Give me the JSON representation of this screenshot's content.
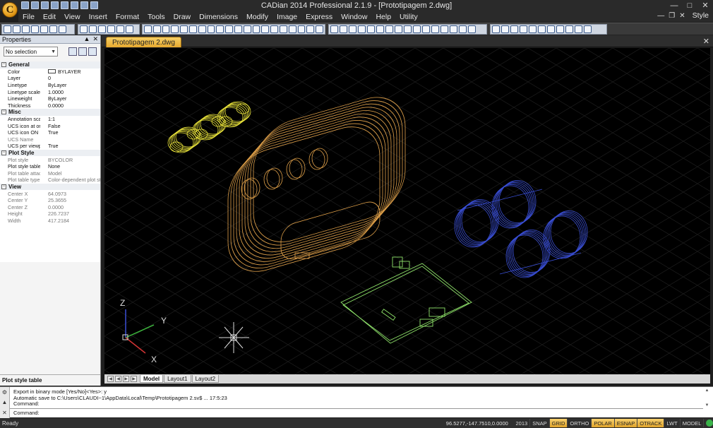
{
  "app": {
    "logo_letter": "C",
    "window_title": "CADian 2014 Professional 2.1.9 - [Prototipagem 2.dwg]"
  },
  "menu": [
    "File",
    "Edit",
    "View",
    "Insert",
    "Format",
    "Tools",
    "Draw",
    "Dimensions",
    "Modify",
    "Image",
    "Express",
    "Window",
    "Help",
    "Utility"
  ],
  "menu_right": {
    "style_label": "Style"
  },
  "document_tab": {
    "label": "Prototipagem 2.dwg"
  },
  "properties": {
    "title": "Properties",
    "selection": "No selection",
    "categories": [
      {
        "name": "General",
        "rows": [
          {
            "name": "Color",
            "value": "BYLAYER",
            "swatch": true
          },
          {
            "name": "Layer",
            "value": "0"
          },
          {
            "name": "Linetype",
            "value": "ByLayer"
          },
          {
            "name": "Linetype scale",
            "value": "1.0000"
          },
          {
            "name": "Lineweight",
            "value": "ByLayer"
          },
          {
            "name": "Thickness",
            "value": "0.0000"
          }
        ]
      },
      {
        "name": "Misc",
        "rows": [
          {
            "name": "Annotation scale",
            "value": "1:1"
          },
          {
            "name": "UCS icon at origin",
            "value": "False"
          },
          {
            "name": "UCS icon ON",
            "value": "True"
          },
          {
            "name": "UCS Name",
            "value": "",
            "dim": true
          },
          {
            "name": "UCS per viewport",
            "value": "True"
          }
        ]
      },
      {
        "name": "Plot Style",
        "rows": [
          {
            "name": "Plot style",
            "value": "BYCOLOR",
            "dim": true
          },
          {
            "name": "Plot style table",
            "value": "None"
          },
          {
            "name": "Plot table attached",
            "value": "Model",
            "dim": true
          },
          {
            "name": "Plot table type",
            "value": "Color-dependent plot sty",
            "dim": true
          }
        ]
      },
      {
        "name": "View",
        "rows": [
          {
            "name": "Center X",
            "value": "64.0973",
            "dim": true
          },
          {
            "name": "Center Y",
            "value": "25.3655",
            "dim": true
          },
          {
            "name": "Center Z",
            "value": "0.0000",
            "dim": true
          },
          {
            "name": "Height",
            "value": "226.7237",
            "dim": true
          },
          {
            "name": "Width",
            "value": "417.2184",
            "dim": true
          }
        ]
      }
    ],
    "description_title": "Plot style table"
  },
  "canvas": {
    "axis_z": "Z",
    "axis_y": "Y",
    "axis_x": "X",
    "colors": {
      "yellow": "#e8e23a",
      "orange": "#e0a14a",
      "blue": "#3a4fd6",
      "green": "#8fe36a"
    }
  },
  "layout_tabs": [
    "Model",
    "Layout1",
    "Layout2"
  ],
  "command": {
    "lines": [
      "Export in binary mode [Yes/No]<Yes>: y",
      "Automatic save to C:\\Users\\CLAUDI~1\\AppData\\Local\\Temp\\Prototipagem 2.sv$ ... 17:5:23",
      "Command:"
    ],
    "prompt": "Command:"
  },
  "status": {
    "ready": "Ready",
    "coords": "96.5277,-147.7510,0.0000",
    "buttons": [
      {
        "label": "2013",
        "on": false
      },
      {
        "label": "SNAP",
        "on": false
      },
      {
        "label": "GRID",
        "on": true
      },
      {
        "label": "ORTHO",
        "on": false
      },
      {
        "label": "POLAR",
        "on": true
      },
      {
        "label": "ESNAP",
        "on": true
      },
      {
        "label": "OTRACK",
        "on": true
      },
      {
        "label": "LWT",
        "on": false
      },
      {
        "label": "MODEL",
        "on": false
      }
    ]
  }
}
